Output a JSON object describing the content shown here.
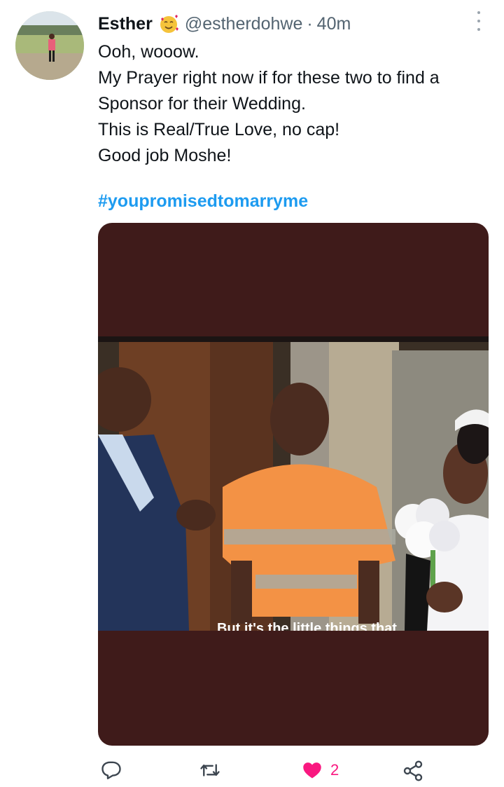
{
  "tweet": {
    "author_name": "Esther",
    "handle": "@estherdohwe",
    "separator": "·",
    "time": "40m",
    "lines": [
      "Ooh, wooow.",
      "My Prayer right now if for these two to find a",
      "Sponsor for their Wedding.",
      "This is Real/True Love, no cap!",
      "Good job Moshe!"
    ],
    "hashtag": "#youpromisedtomarryme",
    "video_subtitle": "But it's the little things that"
  },
  "actions": {
    "reply_icon": "reply-icon",
    "retweet_icon": "retweet-icon",
    "like_icon": "heart-icon",
    "like_count": "2",
    "share_icon": "share-icon"
  },
  "colors": {
    "hashtag": "#1d9bf0",
    "like": "#f91880",
    "media_background": "#3f1b1a",
    "secondary_text": "#536471"
  }
}
